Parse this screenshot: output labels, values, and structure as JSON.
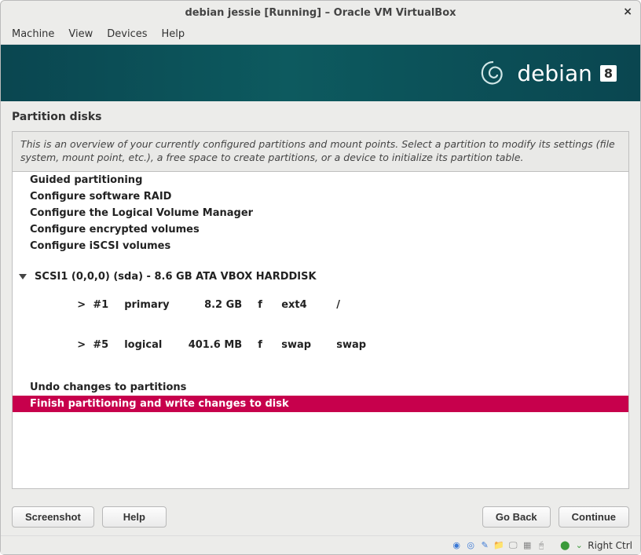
{
  "window": {
    "title": "debian jessie [Running] – Oracle VM VirtualBox"
  },
  "menubar": {
    "machine": "Machine",
    "view": "View",
    "devices": "Devices",
    "help": "Help"
  },
  "banner": {
    "brand": "debian",
    "version": "8"
  },
  "section_title": "Partition disks",
  "description": "This is an overview of your currently configured partitions and mount points. Select a partition to modify its settings (file system, mount point, etc.), a free space to create partitions, or a device to initialize its partition table.",
  "options": {
    "guided": "Guided partitioning",
    "raid": "Configure software RAID",
    "lvm": "Configure the Logical Volume Manager",
    "encrypted": "Configure encrypted volumes",
    "iscsi": "Configure iSCSI volumes"
  },
  "disk": {
    "label": "SCSI1 (0,0,0) (sda) - 8.6 GB ATA VBOX HARDDISK",
    "partitions": [
      {
        "marker": ">",
        "num": "#1",
        "kind": "primary",
        "size": "8.2 GB",
        "flag": "f",
        "fs": "ext4",
        "mount": "/"
      },
      {
        "marker": ">",
        "num": "#5",
        "kind": "logical",
        "size": "401.6 MB",
        "flag": "f",
        "fs": "swap",
        "mount": "swap"
      }
    ]
  },
  "actions": {
    "undo": "Undo changes to partitions",
    "finish": "Finish partitioning and write changes to disk"
  },
  "buttons": {
    "screenshot": "Screenshot",
    "help": "Help",
    "goback": "Go Back",
    "continue": "Continue"
  },
  "statusbar": {
    "hostkey": "Right Ctrl"
  }
}
